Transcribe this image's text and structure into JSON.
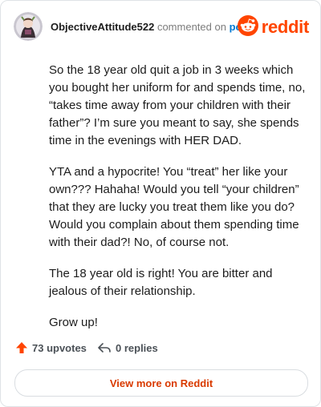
{
  "header": {
    "username": "ObjectiveAttitude522",
    "action_text": "commented on",
    "post_link": "post",
    "brand_name": "reddit"
  },
  "comment": {
    "paragraphs": [
      "So the 18 year old quit a job in 3 weeks which you bought her uniform for and spends time, no, “takes time away from your children with their father”? I’m sure you meant to say, she spends time in the evenings with HER DAD.",
      "YTA and a hypocrite! You “treat” her like your own??? Hahaha! Would you tell “your children” that they are lucky you treat them like you do? Would you complain about them spending time with their dad?! No, of course not.",
      "The 18 year old is right! You are bitter and jealous of their relationship.",
      "Grow up!"
    ]
  },
  "footer": {
    "upvotes": "73 upvotes",
    "replies": "0 replies",
    "upvote_icon": "upvote-arrow-icon",
    "reply_icon": "reply-arrow-icon"
  },
  "view_more_label": "View more on Reddit",
  "colors": {
    "brand": "#ff4500",
    "link": "#0079d3",
    "view_more": "#d93a00"
  }
}
